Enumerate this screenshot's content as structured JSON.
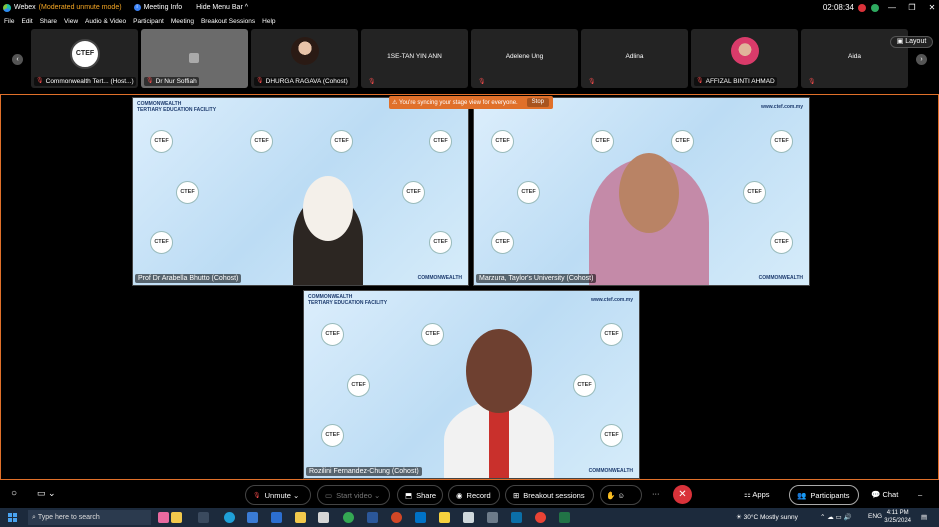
{
  "titlebar": {
    "app_name": "Webex",
    "mode": "(Moderated unmute mode)",
    "meeting_info": "Meeting Info",
    "hide_menu_bar": "Hide Menu Bar",
    "timer": "02:08:34"
  },
  "menu": [
    "File",
    "Edit",
    "Share",
    "View",
    "Audio & Video",
    "Participant",
    "Meeting",
    "Breakout Sessions",
    "Help"
  ],
  "strip": {
    "layout_label": "Layout",
    "participants": [
      {
        "name": "Commonwealth Tert... (Host...)",
        "type": "logo",
        "logo_text": "CTEF"
      },
      {
        "name": "Dr Nur Soffiah",
        "type": "avatar-blank"
      },
      {
        "name": "DHURGA RAGAVA (Cohost)",
        "type": "photo"
      },
      {
        "name": "1SE-TAN YIN ANN",
        "type": "text"
      },
      {
        "name": "Adelene Ung",
        "type": "text"
      },
      {
        "name": "Adlina",
        "type": "text"
      },
      {
        "name": "AFFIZAL BINTI AHMAD",
        "type": "photo"
      },
      {
        "name": "Aida",
        "type": "text"
      }
    ]
  },
  "stage": {
    "sync_message": "You're syncing your stage view for everyone.",
    "stop_label": "Stop",
    "brand_top": "COMMONWEALTH",
    "brand_sub": "TERTIARY EDUCATION FACILITY",
    "url": "www.ctef.com.my",
    "badge": "CTEF",
    "videos": [
      {
        "label": "Prof Dr Arabella Bhutto (Cohost)"
      },
      {
        "label": "Marzura, Taylor's University (Cohost)"
      },
      {
        "label": "Rozilini Fernandez-Chung (Cohost)"
      }
    ]
  },
  "controls": {
    "unmute": "Unmute",
    "start_video": "Start video",
    "share": "Share",
    "record": "Record",
    "breakout": "Breakout sessions",
    "apps": "Apps",
    "participants": "Participants",
    "chat": "Chat",
    "more": "···",
    "end": "✕"
  },
  "taskbar": {
    "search_placeholder": "Type here to search",
    "weather": "30°C  Mostly sunny",
    "lang": "ENG",
    "time": "4:11 PM",
    "date": "3/25/2024"
  },
  "colors": {
    "accent_orange": "#e0702a",
    "end_red": "#d9323a",
    "mute_red": "#f04b4b"
  }
}
